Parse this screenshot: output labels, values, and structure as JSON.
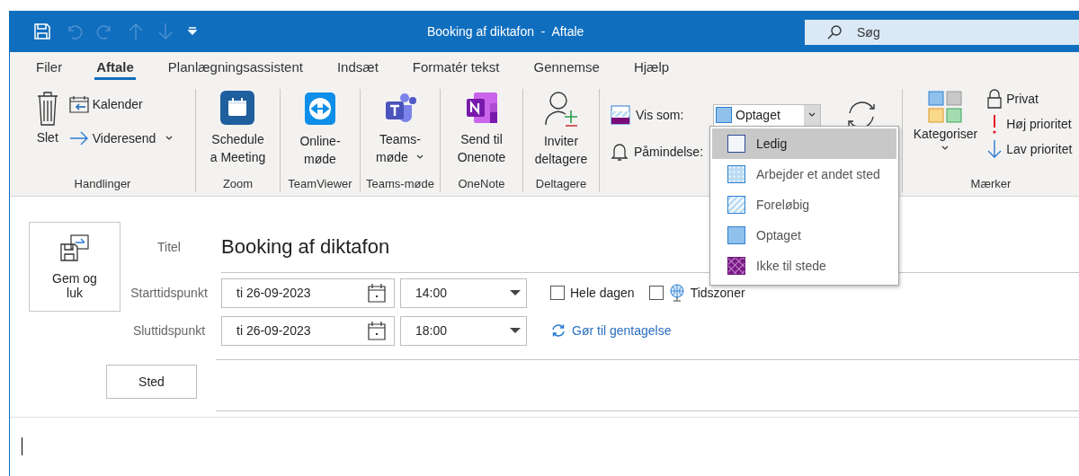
{
  "window": {
    "title": "Booking af diktafon  -  Aftale"
  },
  "search": {
    "placeholder": "Søg"
  },
  "tabs": [
    {
      "label": "Filer",
      "selected": false
    },
    {
      "label": "Aftale",
      "selected": true
    },
    {
      "label": "Planlægningsassistent",
      "selected": false
    },
    {
      "label": "Indsæt",
      "selected": false
    },
    {
      "label": "Formatér tekst",
      "selected": false
    },
    {
      "label": "Gennemse",
      "selected": false
    },
    {
      "label": "Hjælp",
      "selected": false
    }
  ],
  "ribbon": {
    "groups": [
      {
        "kind": "actions",
        "label": "Handlinger",
        "big": {
          "label": "Slet"
        },
        "small": [
          {
            "label": "Kalender",
            "caret": false
          },
          {
            "label": "Videresend",
            "caret": true
          }
        ]
      },
      {
        "kind": "big",
        "label": "Zoom",
        "lines": [
          "Schedule",
          "a Meeting"
        ],
        "caret": false
      },
      {
        "kind": "big",
        "label": "TeamViewer",
        "lines": [
          "Online-",
          "møde"
        ],
        "caret": false
      },
      {
        "kind": "big",
        "label": "Teams-møde",
        "lines": [
          "Teams-",
          "møde"
        ],
        "caret": true
      },
      {
        "kind": "big",
        "label": "OneNote",
        "lines": [
          "Send til",
          "Onenote"
        ],
        "caret": false
      },
      {
        "kind": "big",
        "label": "Deltagere",
        "lines": [
          "Inviter",
          "deltagere"
        ],
        "caret": false
      },
      {
        "kind": "options",
        "show_as": {
          "label": "Vis som:",
          "value": "Optaget",
          "kind": "busy"
        },
        "reminder": {
          "label": "Påmindelse:"
        }
      },
      {
        "kind": "tags",
        "label": "Mærker",
        "categorize": "Kategoriser",
        "small": [
          {
            "label": "Privat"
          },
          {
            "label": "Høj prioritet"
          },
          {
            "label": "Lav prioritet"
          }
        ]
      }
    ]
  },
  "show_as_menu": [
    {
      "label": "Ledig",
      "kind": "free",
      "selected": true
    },
    {
      "label": "Arbejder et andet sted",
      "kind": "elsewhere",
      "selected": false
    },
    {
      "label": "Foreløbig",
      "kind": "tentative",
      "selected": false
    },
    {
      "label": "Optaget",
      "kind": "busy",
      "selected": false
    },
    {
      "label": "Ikke til stede",
      "kind": "away",
      "selected": false
    }
  ],
  "form": {
    "save_close": [
      "Gem og",
      "luk"
    ],
    "title": {
      "label": "Titel",
      "value": "Booking af diktafon"
    },
    "start": {
      "label": "Starttidspunkt",
      "date": "ti 26-09-2023",
      "time": "14:00"
    },
    "end": {
      "label": "Sluttidspunkt",
      "date": "ti 26-09-2023",
      "time": "18:00"
    },
    "all_day": {
      "label": "Hele dagen",
      "checked": false
    },
    "time_zones": {
      "label": "Tidszoner",
      "checked": false
    },
    "recurrence": {
      "label": "Gør til gentagelse"
    },
    "location": {
      "label": "Sted"
    }
  }
}
